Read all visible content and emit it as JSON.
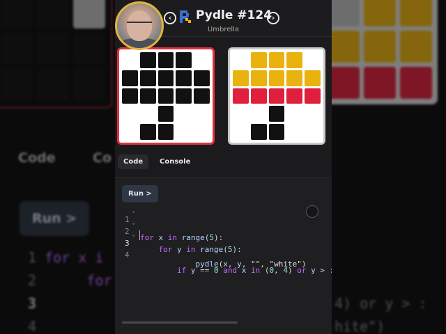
{
  "header": {
    "title": "Pydle #124",
    "subtitle": "Umbrella",
    "prev_glyph": "‹",
    "next_glyph": "›"
  },
  "colors": {
    "white": "#ffffff",
    "black": "#111111",
    "yellow": "#e9b20f",
    "red": "#df1f3b",
    "accent_border": "#e0303e",
    "avatar_ring": "#e2b43a"
  },
  "target_grid": [
    [
      "white",
      "black",
      "black",
      "black",
      "white"
    ],
    [
      "black",
      "black",
      "black",
      "black",
      "black"
    ],
    [
      "black",
      "black",
      "black",
      "black",
      "black"
    ],
    [
      "white",
      "white",
      "black",
      "white",
      "white"
    ],
    [
      "white",
      "black",
      "black",
      "white",
      "white"
    ]
  ],
  "solution_grid": [
    [
      "white",
      "yellow",
      "yellow",
      "yellow",
      "white"
    ],
    [
      "yellow",
      "yellow",
      "yellow",
      "yellow",
      "yellow"
    ],
    [
      "red",
      "red",
      "red",
      "red",
      "red"
    ],
    [
      "white",
      "white",
      "black",
      "white",
      "white"
    ],
    [
      "white",
      "black",
      "black",
      "white",
      "white"
    ]
  ],
  "tabs": [
    {
      "label": "Code",
      "active": true
    },
    {
      "label": "Console",
      "active": false
    }
  ],
  "editor": {
    "run_label": "Run >",
    "lines": [
      {
        "num": "1",
        "text": "for x in range(5):"
      },
      {
        "num": "2",
        "text": "    for y in range(5):"
      },
      {
        "num": "3",
        "text": "        if y == 0 and x in (0, 4) or y > :"
      },
      {
        "num": "4",
        "text": "            pydle(x, y, \"\", \"white\")"
      }
    ]
  },
  "background": {
    "tab_code": "Code",
    "tab_console": "Co",
    "run_label": "Run >",
    "line1": "for x i",
    "line2": "for",
    "right_line3": "4) or y > :",
    "right_line4": "hite\")"
  }
}
